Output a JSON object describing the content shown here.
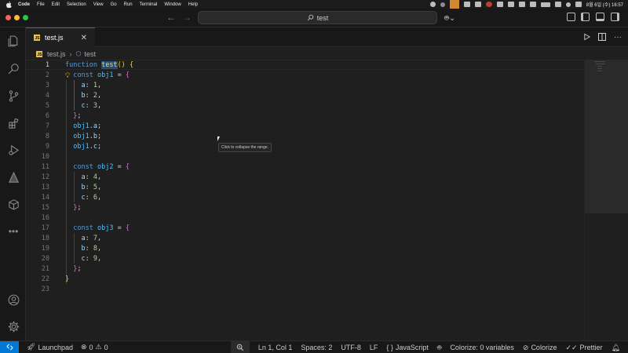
{
  "menubar": {
    "items": [
      "Code",
      "File",
      "Edit",
      "Selection",
      "View",
      "Go",
      "Run",
      "Terminal",
      "Window",
      "Help"
    ],
    "clock": "8월 6일 (수) 16:57"
  },
  "titlebar": {
    "search_text": "test"
  },
  "tab": {
    "filename": "test.js",
    "close_glyph": "✕",
    "icon_text": "JS"
  },
  "breadcrumb": {
    "file": "test.js",
    "symbol": "test"
  },
  "editor": {
    "line_numbers": [
      "1",
      "2",
      "3",
      "4",
      "5",
      "6",
      "7",
      "8",
      "9",
      "10",
      "11",
      "12",
      "13",
      "14",
      "15",
      "16",
      "17",
      "18",
      "19",
      "20",
      "21",
      "22",
      "23"
    ],
    "tooltip": "Click to collapse the range.",
    "colors": {
      "keyword": "#569cd6",
      "function": "#dcdcaa",
      "bracket_gold": "#ffd700",
      "bracket_purple": "#da70d6",
      "variable": "#4fc1ff",
      "property": "#9cdcfe",
      "number": "#b5cea8"
    }
  },
  "statusbar": {
    "remote_icon": "remote-icon",
    "launchpad": "Launchpad",
    "errors": "0",
    "warnings": "0",
    "position": "Ln 1, Col 1",
    "spaces": "Spaces: 2",
    "encoding": "UTF-8",
    "eol": "LF",
    "language": "JavaScript",
    "colorize_vars": "Colorize: 0 variables",
    "colorize": "Colorize",
    "prettier": "Prettier"
  }
}
